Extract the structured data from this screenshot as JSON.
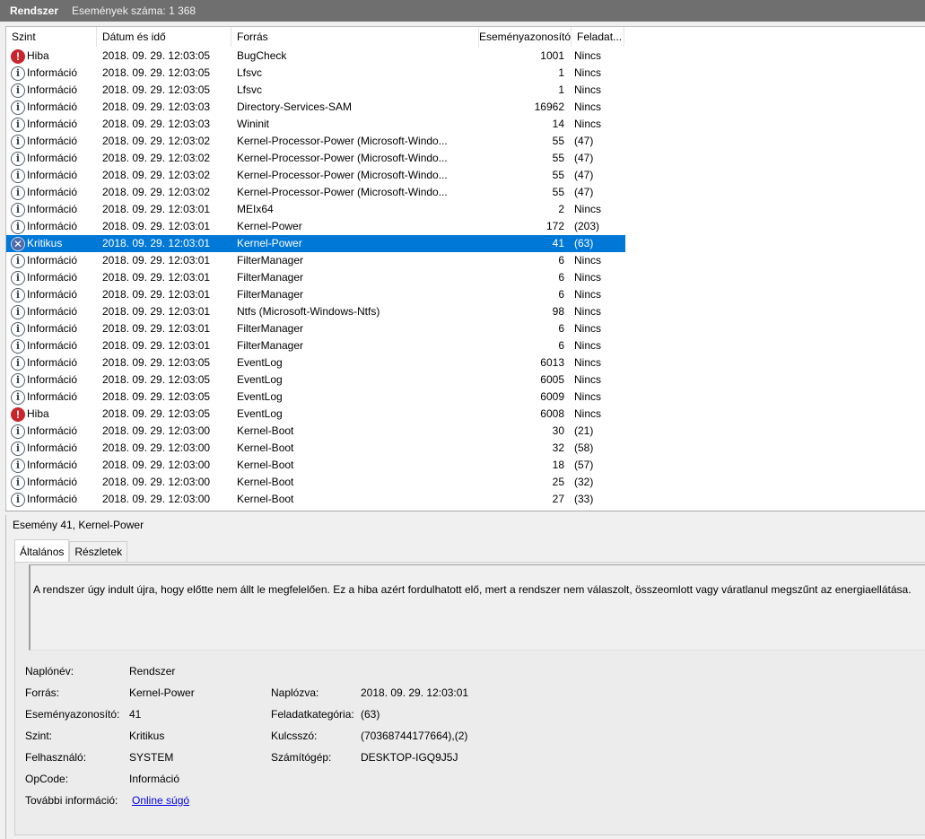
{
  "titlebar": {
    "log_name": "Rendszer",
    "count": "Események száma: 1 368"
  },
  "columns": [
    "Szint",
    "Dátum és idő",
    "Forrás",
    "Eseményazonosító",
    "Feladat..."
  ],
  "events": [
    {
      "level": "Hiba",
      "icon": "error",
      "date": "2018. 09. 29. 12:03:05",
      "source": "BugCheck",
      "id": "1001",
      "task": "Nincs"
    },
    {
      "level": "Információ",
      "icon": "info",
      "date": "2018. 09. 29. 12:03:05",
      "source": "Lfsvc",
      "id": "1",
      "task": "Nincs"
    },
    {
      "level": "Információ",
      "icon": "info",
      "date": "2018. 09. 29. 12:03:05",
      "source": "Lfsvc",
      "id": "1",
      "task": "Nincs"
    },
    {
      "level": "Információ",
      "icon": "info",
      "date": "2018. 09. 29. 12:03:03",
      "source": "Directory-Services-SAM",
      "id": "16962",
      "task": "Nincs"
    },
    {
      "level": "Információ",
      "icon": "info",
      "date": "2018. 09. 29. 12:03:03",
      "source": "Wininit",
      "id": "14",
      "task": "Nincs"
    },
    {
      "level": "Információ",
      "icon": "info",
      "date": "2018. 09. 29. 12:03:02",
      "source": "Kernel-Processor-Power (Microsoft-Windo...",
      "id": "55",
      "task": "(47)"
    },
    {
      "level": "Információ",
      "icon": "info",
      "date": "2018. 09. 29. 12:03:02",
      "source": "Kernel-Processor-Power (Microsoft-Windo...",
      "id": "55",
      "task": "(47)"
    },
    {
      "level": "Információ",
      "icon": "info",
      "date": "2018. 09. 29. 12:03:02",
      "source": "Kernel-Processor-Power (Microsoft-Windo...",
      "id": "55",
      "task": "(47)"
    },
    {
      "level": "Információ",
      "icon": "info",
      "date": "2018. 09. 29. 12:03:02",
      "source": "Kernel-Processor-Power (Microsoft-Windo...",
      "id": "55",
      "task": "(47)"
    },
    {
      "level": "Információ",
      "icon": "info",
      "date": "2018. 09. 29. 12:03:01",
      "source": "MEIx64",
      "id": "2",
      "task": "Nincs"
    },
    {
      "level": "Információ",
      "icon": "info",
      "date": "2018. 09. 29. 12:03:01",
      "source": "Kernel-Power",
      "id": "172",
      "task": "(203)"
    },
    {
      "level": "Kritikus",
      "icon": "critical",
      "date": "2018. 09. 29. 12:03:01",
      "source": "Kernel-Power",
      "id": "41",
      "task": "(63)",
      "selected": true
    },
    {
      "level": "Információ",
      "icon": "info",
      "date": "2018. 09. 29. 12:03:01",
      "source": "FilterManager",
      "id": "6",
      "task": "Nincs"
    },
    {
      "level": "Információ",
      "icon": "info",
      "date": "2018. 09. 29. 12:03:01",
      "source": "FilterManager",
      "id": "6",
      "task": "Nincs"
    },
    {
      "level": "Információ",
      "icon": "info",
      "date": "2018. 09. 29. 12:03:01",
      "source": "FilterManager",
      "id": "6",
      "task": "Nincs"
    },
    {
      "level": "Információ",
      "icon": "info",
      "date": "2018. 09. 29. 12:03:01",
      "source": "Ntfs (Microsoft-Windows-Ntfs)",
      "id": "98",
      "task": "Nincs"
    },
    {
      "level": "Információ",
      "icon": "info",
      "date": "2018. 09. 29. 12:03:01",
      "source": "FilterManager",
      "id": "6",
      "task": "Nincs"
    },
    {
      "level": "Információ",
      "icon": "info",
      "date": "2018. 09. 29. 12:03:01",
      "source": "FilterManager",
      "id": "6",
      "task": "Nincs"
    },
    {
      "level": "Információ",
      "icon": "info",
      "date": "2018. 09. 29. 12:03:05",
      "source": "EventLog",
      "id": "6013",
      "task": "Nincs"
    },
    {
      "level": "Információ",
      "icon": "info",
      "date": "2018. 09. 29. 12:03:05",
      "source": "EventLog",
      "id": "6005",
      "task": "Nincs"
    },
    {
      "level": "Információ",
      "icon": "info",
      "date": "2018. 09. 29. 12:03:05",
      "source": "EventLog",
      "id": "6009",
      "task": "Nincs"
    },
    {
      "level": "Hiba",
      "icon": "error",
      "date": "2018. 09. 29. 12:03:05",
      "source": "EventLog",
      "id": "6008",
      "task": "Nincs"
    },
    {
      "level": "Információ",
      "icon": "info",
      "date": "2018. 09. 29. 12:03:00",
      "source": "Kernel-Boot",
      "id": "30",
      "task": "(21)"
    },
    {
      "level": "Információ",
      "icon": "info",
      "date": "2018. 09. 29. 12:03:00",
      "source": "Kernel-Boot",
      "id": "32",
      "task": "(58)"
    },
    {
      "level": "Információ",
      "icon": "info",
      "date": "2018. 09. 29. 12:03:00",
      "source": "Kernel-Boot",
      "id": "18",
      "task": "(57)"
    },
    {
      "level": "Információ",
      "icon": "info",
      "date": "2018. 09. 29. 12:03:00",
      "source": "Kernel-Boot",
      "id": "25",
      "task": "(32)"
    },
    {
      "level": "Információ",
      "icon": "info",
      "date": "2018. 09. 29. 12:03:00",
      "source": "Kernel-Boot",
      "id": "27",
      "task": "(33)"
    }
  ],
  "details": {
    "title": "Esemény 41, Kernel-Power",
    "tabs": [
      "Általános",
      "Részletek"
    ],
    "description": "A rendszer úgy indult újra, hogy előtte nem állt le megfelelően. Ez a hiba azért fordulhatott elő, mert a rendszer nem válaszolt, összeomlott vagy váratlanul megszűnt az energiaellátása.",
    "props": {
      "log_label": "Naplónév:",
      "log_value": "Rendszer",
      "source_label": "Forrás:",
      "source_value": "Kernel-Power",
      "logged_label": "Naplózva:",
      "logged_value": "2018. 09. 29. 12:03:01",
      "id_label": "Eseményazonosító:",
      "id_value": "41",
      "task_label": "Feladatkategória:",
      "task_value": "(63)",
      "level_label": "Szint:",
      "level_value": "Kritikus",
      "keywords_label": "Kulcsszó:",
      "keywords_value": "(70368744177664),(2)",
      "user_label": "Felhasználó:",
      "user_value": "SYSTEM",
      "computer_label": "Számítógép:",
      "computer_value": "DESKTOP-IGQ9J5J",
      "opcode_label": "OpCode:",
      "opcode_value": "Információ",
      "more_label": "További információ:",
      "more_link": "Online súgó"
    }
  },
  "colors": {
    "selected": "#0078d7",
    "titlebar": "#6f6f6f",
    "link": "#0000e6"
  }
}
